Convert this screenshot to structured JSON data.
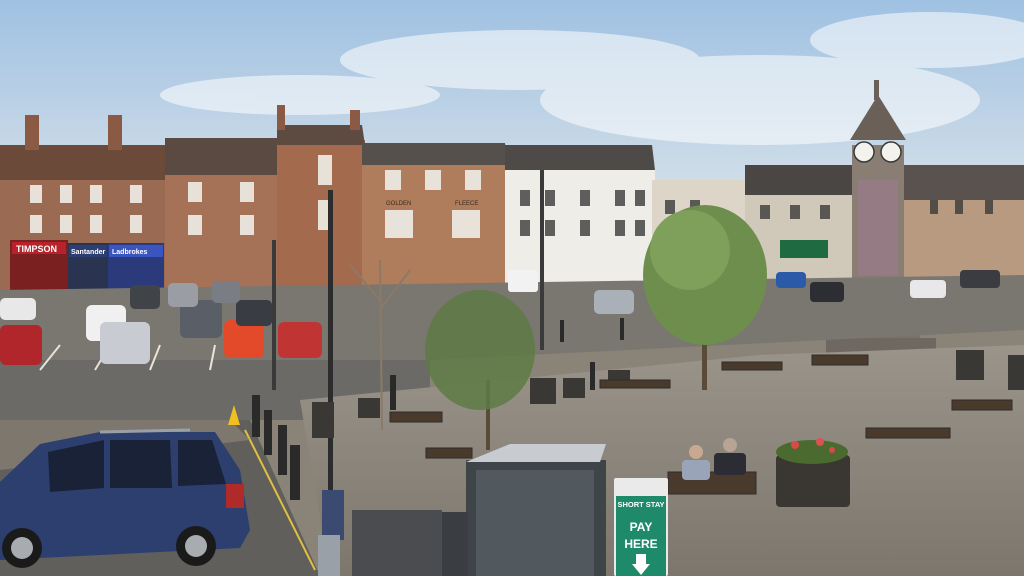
{
  "scene": {
    "shop_signs": {
      "timpson": "TIMPSON",
      "santander": "Santander",
      "ladbrokes": "Ladbrokes",
      "golden": "GOLDEN",
      "fleece": "FLEECE"
    },
    "parking_sign": {
      "line1": "SHORT STAY",
      "line2": "PAY",
      "line3": "HERE"
    },
    "colors": {
      "sky": "#a9c8e4",
      "brick": "#9a6a50",
      "pavement": "#8e877b",
      "road": "#6f6d69",
      "car_blue": "#2c3f6e",
      "sign_green": "#1f8a6a"
    }
  }
}
